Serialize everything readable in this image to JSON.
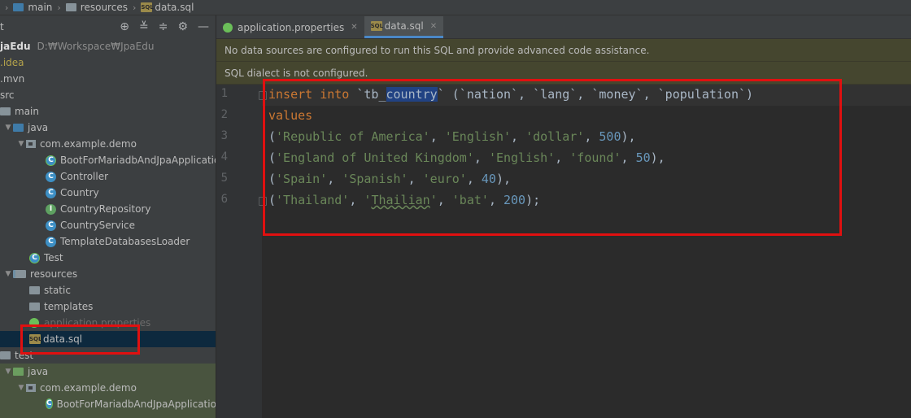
{
  "breadcrumb": [
    "main",
    "resources",
    "data.sql"
  ],
  "sidebar": {
    "project_name": "jaEdu",
    "project_path": "D:₩Workspace₩JpaEdu",
    "items": [
      {
        "label": ".idea"
      },
      {
        "label": ".mvn"
      },
      {
        "label": "src"
      },
      {
        "label": "main"
      },
      {
        "label": "java"
      },
      {
        "label": "com.example.demo"
      },
      {
        "label": "BootForMariadbAndJpaApplication"
      },
      {
        "label": "Controller"
      },
      {
        "label": "Country"
      },
      {
        "label": "CountryRepository"
      },
      {
        "label": "CountryService"
      },
      {
        "label": "TemplateDatabasesLoader"
      },
      {
        "label": "Test"
      },
      {
        "label": "resources"
      },
      {
        "label": "static"
      },
      {
        "label": "templates"
      },
      {
        "label": "application.properties"
      },
      {
        "label": "data.sql"
      },
      {
        "label": "test"
      },
      {
        "label": "java"
      },
      {
        "label": "com.example.demo"
      },
      {
        "label": "BootForMariadbAndJpaApplicationT"
      }
    ],
    "header_fragment": "t"
  },
  "tabs": [
    {
      "label": "application.properties",
      "active": false
    },
    {
      "label": "data.sql",
      "active": true
    }
  ],
  "banners": [
    "No data sources are configured to run this SQL and provide advanced code assistance.",
    "SQL dialect is not configured."
  ],
  "editor": {
    "line_numbers": [
      "1",
      "2",
      "3",
      "4",
      "5",
      "6"
    ]
  },
  "colors": {
    "annotation_box": "#e01010",
    "keyword": "#cc7832",
    "string": "#6a8759",
    "number": "#6897bb"
  },
  "icons": [
    "sql-file-icon",
    "spring-leaf-icon",
    "folder-icon",
    "package-icon",
    "class-icon",
    "interface-icon",
    "target-icon",
    "expand-all-icon",
    "collapse-all-icon",
    "gear-icon",
    "minimize-icon"
  ]
}
